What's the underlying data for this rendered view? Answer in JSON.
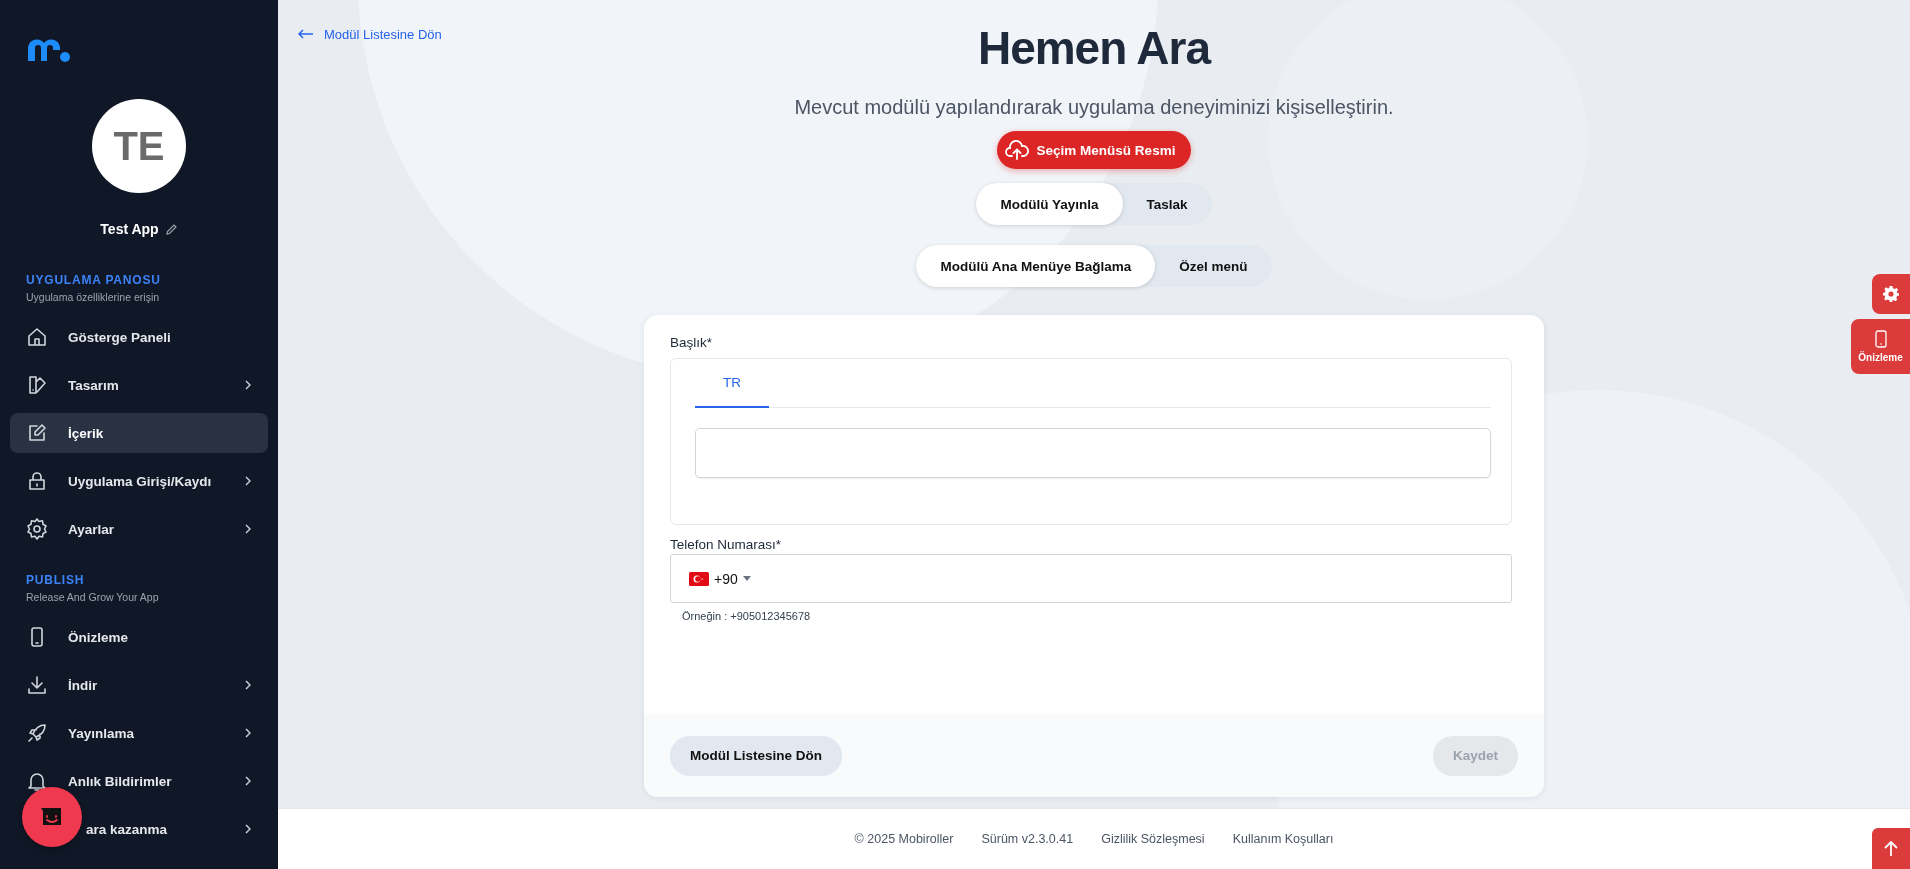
{
  "sidebar": {
    "avatar_initials": "TE",
    "app_name": "Test App",
    "sections": [
      {
        "title": "UYGULAMA PANOSU",
        "subtitle": "Uygulama özelliklerine erişin",
        "items": [
          {
            "label": "Gösterge Paneli",
            "has_submenu": false,
            "selected": false
          },
          {
            "label": "Tasarım",
            "has_submenu": true,
            "selected": false
          },
          {
            "label": "İçerik",
            "has_submenu": false,
            "selected": true
          },
          {
            "label": "Uygulama Girişi/Kaydı",
            "has_submenu": true,
            "selected": false
          },
          {
            "label": "Ayarlar",
            "has_submenu": true,
            "selected": false
          }
        ]
      },
      {
        "title": "PUBLISH",
        "subtitle": "Release And Grow Your App",
        "items": [
          {
            "label": "Önizleme",
            "has_submenu": false,
            "selected": false
          },
          {
            "label": "İndir",
            "has_submenu": true,
            "selected": false
          },
          {
            "label": "Yayınlama",
            "has_submenu": true,
            "selected": false
          },
          {
            "label": "Anlık Bildirimler",
            "has_submenu": true,
            "selected": false
          },
          {
            "label": "ara kazanma",
            "has_submenu": true,
            "selected": false
          }
        ]
      }
    ]
  },
  "back_link": "Modül Listesine Dön",
  "header": {
    "title": "Hemen Ara",
    "subtitle": "Mevcut modülü yapılandırarak uygulama deneyiminizi kişiselleştirin.",
    "upload_button": "Seçim Menüsü Resmi"
  },
  "publish_toggle": [
    {
      "label": "Modülü Yayınla",
      "selected": true
    },
    {
      "label": "Taslak",
      "selected": false
    }
  ],
  "menu_toggle": [
    {
      "label": "Modülü Ana Menüye Bağlama",
      "selected": true
    },
    {
      "label": "Özel menü",
      "selected": false
    }
  ],
  "form": {
    "title_field": {
      "label": "Başlık*",
      "tabs": [
        {
          "label": "TR",
          "selected": true
        }
      ]
    },
    "phone_field": {
      "label": "Telefon Numarası*",
      "dial_code": "+90",
      "hint": "Örneğin : +905012345678"
    },
    "back_button": "Modül Listesine Dön",
    "save_button": {
      "label": "Kaydet",
      "disabled": true
    }
  },
  "preview_button": "Önizleme",
  "footer": [
    "© 2025 Mobiroller",
    "Sürüm v2.3.0.41",
    "Gizlilik Sözleşmesi",
    "Kullanım Koşulları"
  ]
}
